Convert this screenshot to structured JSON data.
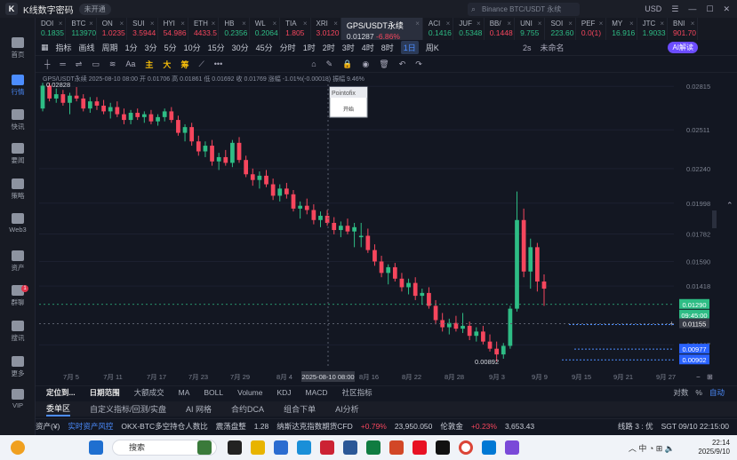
{
  "window": {
    "title": "K线数字密码",
    "badge": "未开通"
  },
  "search": {
    "placeholder": "Binance BTC/USDT 永续"
  },
  "titlebar_right": {
    "currency": "USD"
  },
  "sidebar": [
    {
      "label": "首页",
      "icon": "home-icon"
    },
    {
      "label": "行情",
      "icon": "chart-icon",
      "active": true
    },
    {
      "label": "快讯",
      "icon": "news-icon"
    },
    {
      "label": "要闻",
      "icon": "newspaper-icon"
    },
    {
      "label": "策略",
      "icon": "strategy-icon"
    },
    {
      "label": "Web3",
      "icon": "web3-icon"
    },
    {
      "label": "资产",
      "icon": "wallet-icon"
    },
    {
      "label": "群聊",
      "icon": "chat-icon",
      "badge": "1"
    },
    {
      "label": "搜讯",
      "icon": "search-news-icon"
    },
    {
      "label": "更多",
      "icon": "more-icon"
    },
    {
      "label": "VIP",
      "icon": "vip-icon"
    }
  ],
  "tickers": [
    {
      "name": "DOI",
      "price": "0.1835",
      "dir": "up"
    },
    {
      "name": "BTC",
      "price": "113970",
      "dir": "up"
    },
    {
      "name": "ON",
      "price": "1.0235",
      "dir": "dn"
    },
    {
      "name": "SUI",
      "price": "3.5944",
      "dir": "dn"
    },
    {
      "name": "HYI",
      "price": "54.986",
      "dir": "dn"
    },
    {
      "name": "ETH",
      "price": "4433.5",
      "dir": "dn"
    },
    {
      "name": "HB",
      "price": "0.2356",
      "dir": "up"
    },
    {
      "name": "WL",
      "price": "0.2064",
      "dir": "up"
    },
    {
      "name": "TIA",
      "price": "1.805",
      "dir": "dn"
    },
    {
      "name": "XRI",
      "price": "3.0120",
      "dir": "dn"
    },
    {
      "name": "GPS/USDT永续",
      "price": "0.01287",
      "change": "-6.86%",
      "dir": "dn",
      "active": true
    },
    {
      "name": "ACI",
      "price": "0.1416",
      "dir": "up"
    },
    {
      "name": "JUF",
      "price": "0.5348",
      "dir": "up"
    },
    {
      "name": "BB/",
      "price": "0.1448",
      "dir": "dn"
    },
    {
      "name": "UNI",
      "price": "9.755",
      "dir": "up"
    },
    {
      "name": "SOI",
      "price": "223.60",
      "dir": "up"
    },
    {
      "name": "PEF",
      "price": "0.0(1)",
      "dir": "dn"
    },
    {
      "name": "MY",
      "price": "16.916",
      "dir": "up"
    },
    {
      "name": "JTC",
      "price": "1.9033",
      "dir": "up"
    },
    {
      "name": "BNI",
      "price": "901.70",
      "dir": "dn"
    }
  ],
  "toolbar1": {
    "items": [
      "指标",
      "画线",
      "周期",
      "1分",
      "3分",
      "5分",
      "10分",
      "15分",
      "30分",
      "45分",
      "分时",
      "1时",
      "2时",
      "3时",
      "4时",
      "8时",
      "1日",
      "周K"
    ],
    "selected": "1日",
    "right": [
      "2s",
      "未命名"
    ],
    "ai_button": "AI解读"
  },
  "toolbar2": {
    "items": [
      "Aa",
      "主",
      "大",
      "筹"
    ]
  },
  "chart_data": {
    "type": "candlestick",
    "symbol": "GPS/USDT永续",
    "info_line": "GPS/USDT永续 2025-08-10 08:00 开 0.01706 高 0.01861 低 0.01692 收 0.01769 涨幅 -1.01%(-0.00018) 振幅 9.46%",
    "y_ticks": [
      "0.02815",
      "0.02511",
      "0.02240",
      "0.01998",
      "0.01782",
      "0.01590",
      "0.01418",
      "0.01007"
    ],
    "x_ticks": [
      "7月 5",
      "7月 11",
      "7月 17",
      "7月 23",
      "7月 29",
      "8月 4",
      "8月 16",
      "8月 22",
      "8月 28",
      "9月 3",
      "9月 9",
      "9月 15",
      "9月 21",
      "9月 27"
    ],
    "crosshair_x_label": "2025-08-10 08:00",
    "high_label": "0.02828",
    "low_label": "0.00892",
    "price_labels": [
      {
        "value": "0.01290",
        "kind": "last"
      },
      {
        "value": "09:45:00",
        "kind": "countdown"
      },
      {
        "value": "0.01155",
        "kind": "crosshair"
      },
      {
        "value": "0.00977",
        "kind": "level"
      },
      {
        "value": "0.00902",
        "kind": "level"
      }
    ],
    "tooltip": {
      "title": "Pointofix",
      "button": "开始"
    },
    "candles": [
      [
        0.0266,
        0.0284,
        0.0264,
        0.0282
      ],
      [
        0.0282,
        0.0284,
        0.0271,
        0.0273
      ],
      [
        0.0273,
        0.028,
        0.027,
        0.0276
      ],
      [
        0.0276,
        0.0279,
        0.0268,
        0.027
      ],
      [
        0.027,
        0.0277,
        0.0262,
        0.0275
      ],
      [
        0.0275,
        0.0281,
        0.0271,
        0.0273
      ],
      [
        0.0273,
        0.0276,
        0.0264,
        0.0266
      ],
      [
        0.0266,
        0.0274,
        0.0263,
        0.0271
      ],
      [
        0.0271,
        0.0274,
        0.0265,
        0.0268
      ],
      [
        0.0268,
        0.0272,
        0.0262,
        0.0264
      ],
      [
        0.0264,
        0.027,
        0.0259,
        0.0267
      ],
      [
        0.0267,
        0.0271,
        0.026,
        0.0262
      ],
      [
        0.0262,
        0.0266,
        0.0255,
        0.0258
      ],
      [
        0.0258,
        0.0265,
        0.0255,
        0.0263
      ],
      [
        0.0263,
        0.0266,
        0.0258,
        0.026
      ],
      [
        0.026,
        0.0264,
        0.0256,
        0.0262
      ],
      [
        0.0262,
        0.0265,
        0.0255,
        0.0257
      ],
      [
        0.0257,
        0.0262,
        0.0254,
        0.026
      ],
      [
        0.026,
        0.0266,
        0.0257,
        0.0264
      ],
      [
        0.0264,
        0.0267,
        0.0256,
        0.0258
      ],
      [
        0.0258,
        0.0261,
        0.0247,
        0.0249
      ],
      [
        0.0249,
        0.0255,
        0.0243,
        0.0253
      ],
      [
        0.0253,
        0.0256,
        0.024,
        0.0243
      ],
      [
        0.0243,
        0.0247,
        0.0233,
        0.0236
      ],
      [
        0.0236,
        0.0243,
        0.0232,
        0.024
      ],
      [
        0.024,
        0.0244,
        0.0226,
        0.0229
      ],
      [
        0.0229,
        0.0235,
        0.0223,
        0.0232
      ],
      [
        0.0232,
        0.0237,
        0.0226,
        0.0228
      ],
      [
        0.0228,
        0.0244,
        0.0225,
        0.0242
      ],
      [
        0.0242,
        0.0246,
        0.0228,
        0.023
      ],
      [
        0.023,
        0.0233,
        0.0218,
        0.022
      ],
      [
        0.022,
        0.0224,
        0.0212,
        0.0216
      ],
      [
        0.0216,
        0.0222,
        0.021,
        0.0219
      ],
      [
        0.0219,
        0.0223,
        0.0211,
        0.0213
      ],
      [
        0.0213,
        0.0217,
        0.0202,
        0.0205
      ],
      [
        0.0205,
        0.0213,
        0.0201,
        0.021
      ],
      [
        0.021,
        0.0214,
        0.0203,
        0.0206
      ],
      [
        0.0206,
        0.0209,
        0.0194,
        0.0196
      ],
      [
        0.0196,
        0.0201,
        0.0189,
        0.0198
      ],
      [
        0.0198,
        0.0203,
        0.0192,
        0.0195
      ],
      [
        0.0195,
        0.0199,
        0.0185,
        0.0188
      ],
      [
        0.0188,
        0.0194,
        0.0183,
        0.0191
      ],
      [
        0.0191,
        0.0195,
        0.0184,
        0.0186
      ],
      [
        0.0186,
        0.019,
        0.0178,
        0.0181
      ],
      [
        0.0181,
        0.0187,
        0.0176,
        0.0184
      ],
      [
        0.0184,
        0.0189,
        0.0178,
        0.018
      ],
      [
        0.018,
        0.0186,
        0.0169,
        0.0183
      ],
      [
        0.0176,
        0.0186,
        0.0169,
        0.0177
      ],
      [
        0.0177,
        0.0182,
        0.0165,
        0.0167
      ],
      [
        0.0167,
        0.0171,
        0.0156,
        0.0159
      ],
      [
        0.0159,
        0.0163,
        0.0148,
        0.0151
      ],
      [
        0.0151,
        0.0157,
        0.0143,
        0.0155
      ],
      [
        0.0155,
        0.0158,
        0.0145,
        0.0147
      ],
      [
        0.0147,
        0.0151,
        0.0138,
        0.0141
      ],
      [
        0.0141,
        0.0147,
        0.0136,
        0.0144
      ],
      [
        0.0144,
        0.0148,
        0.0132,
        0.0135
      ],
      [
        0.0135,
        0.014,
        0.0129,
        0.0137
      ],
      [
        0.0137,
        0.0141,
        0.0126,
        0.0128
      ],
      [
        0.0128,
        0.0132,
        0.0115,
        0.0118
      ],
      [
        0.0118,
        0.0123,
        0.011,
        0.0113
      ],
      [
        0.0113,
        0.0119,
        0.0108,
        0.0116
      ],
      [
        0.0116,
        0.0121,
        0.011,
        0.0112
      ],
      [
        0.0112,
        0.0123,
        0.0109,
        0.0114
      ],
      [
        0.0114,
        0.0117,
        0.0104,
        0.0107
      ],
      [
        0.0107,
        0.0113,
        0.0103,
        0.011
      ],
      [
        0.011,
        0.0114,
        0.0101,
        0.0103
      ],
      [
        0.0103,
        0.0108,
        0.0096,
        0.0098
      ],
      [
        0.0098,
        0.0103,
        0.0089,
        0.0094
      ],
      [
        0.0094,
        0.0102,
        0.0091,
        0.01
      ],
      [
        0.01,
        0.0128,
        0.0098,
        0.0126
      ],
      [
        0.0126,
        0.0208,
        0.0124,
        0.0188
      ],
      [
        0.0188,
        0.0196,
        0.0148,
        0.0152
      ],
      [
        0.0152,
        0.0175,
        0.014,
        0.0169
      ],
      [
        0.0169,
        0.0172,
        0.0138,
        0.0145
      ],
      [
        0.0145,
        0.015,
        0.0128,
        0.014
      ]
    ]
  },
  "indicator_bar": {
    "items": [
      "定位到...",
      "日期范围",
      "大额成交",
      "MA",
      "BOLL",
      "Volume",
      "KDJ",
      "MACD",
      "社区指标"
    ],
    "right": [
      "对数",
      "%",
      "自动"
    ]
  },
  "bottom_tabs": {
    "items": [
      "委单区",
      "自定义指标/回测/实盘",
      "AI 网格",
      "合约DCA",
      "组合下单",
      "AI分析"
    ],
    "active": "委单区"
  },
  "status_bar": {
    "assets": "资产(¥)",
    "risk": "实时资产风控",
    "ticker1": "OKX-BTC多空持仓人数比",
    "ticker1_label": "震荡盘整",
    "ticker1_value": "1.28",
    "ticker2": "纳斯达克指数期货CFD",
    "ticker2_change": "+0.79%",
    "ticker2_value": "23,950.050",
    "ticker3": "伦敦金",
    "ticker3_change": "+0.23%",
    "ticker3_value": "3,653.43",
    "line": "线路 3 : 优",
    "time": "SGT 09/10 22:15:00"
  },
  "taskbar": {
    "search": "搜索",
    "weather": "31°C",
    "time": "22:14",
    "date": "2025/9/10"
  }
}
